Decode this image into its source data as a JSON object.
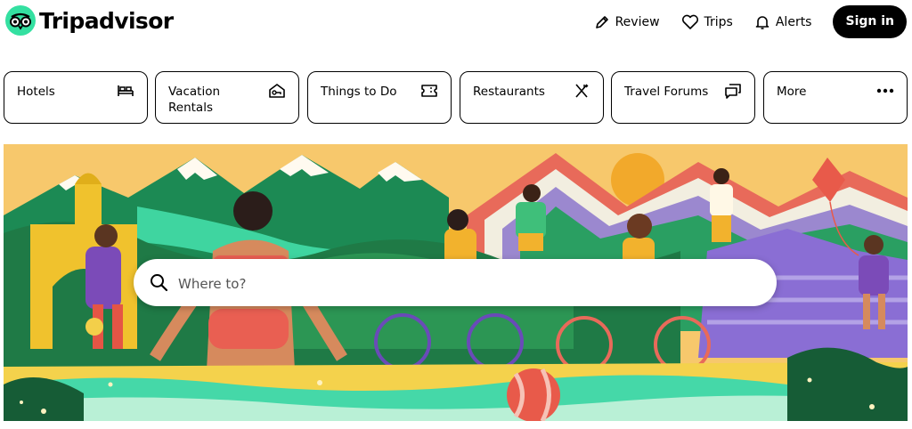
{
  "brand": {
    "name": "Tripadvisor",
    "logo_color": "#34e0a1"
  },
  "nav": {
    "review": {
      "label": "Review",
      "icon": "pencil-icon"
    },
    "trips": {
      "label": "Trips",
      "icon": "heart-icon"
    },
    "alerts": {
      "label": "Alerts",
      "icon": "bell-icon"
    },
    "signin": {
      "label": "Sign in"
    }
  },
  "categories": [
    {
      "label": "Hotels",
      "icon": "bed-icon"
    },
    {
      "label": "Vacation Rentals",
      "icon": "house-key-icon"
    },
    {
      "label": "Things to Do",
      "icon": "ticket-icon"
    },
    {
      "label": "Restaurants",
      "icon": "utensils-icon"
    },
    {
      "label": "Travel Forums",
      "icon": "chat-bubbles-icon"
    },
    {
      "label": "More",
      "icon": "ellipsis-icon"
    }
  ],
  "search": {
    "placeholder": "Where to?",
    "value": ""
  }
}
